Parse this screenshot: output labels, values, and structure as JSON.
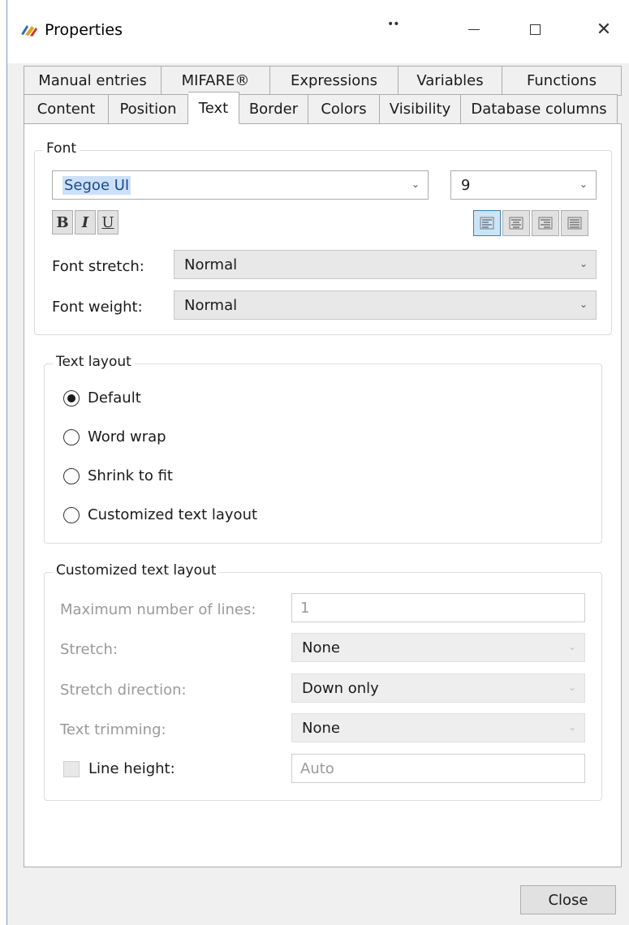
{
  "window": {
    "title": "Properties",
    "grip_glyph": "••",
    "minimize_label": "",
    "maximize_label": "",
    "close_glyph": "✕"
  },
  "tabs": {
    "back_row": [
      "Manual entries",
      "MIFARE®",
      "Expressions",
      "Variables",
      "Functions"
    ],
    "front_row": [
      "Content",
      "Position",
      "Text",
      "Border",
      "Colors",
      "Visibility",
      "Database columns"
    ],
    "active": "Text"
  },
  "font_group": {
    "label": "Font",
    "font_family": "Segoe UI",
    "font_size": "9",
    "bold_label": "B",
    "italic_label": "I",
    "underline_label": "U",
    "alignment_selected": "left",
    "font_stretch_label": "Font stretch:",
    "font_stretch_value": "Normal",
    "font_weight_label": "Font weight:",
    "font_weight_value": "Normal"
  },
  "text_layout": {
    "label": "Text layout",
    "options": [
      "Default",
      "Word wrap",
      "Shrink to fit",
      "Customized text layout"
    ],
    "selected": "Default"
  },
  "custom_layout": {
    "label": "Customized text layout",
    "max_lines_label": "Maximum number of lines:",
    "max_lines_value": "1",
    "stretch_label": "Stretch:",
    "stretch_value": "None",
    "stretch_direction_label": "Stretch direction:",
    "stretch_direction_value": "Down only",
    "text_trimming_label": "Text trimming:",
    "text_trimming_value": "None",
    "line_height_label": "Line height:",
    "line_height_value": "Auto",
    "line_height_checked": false
  },
  "footer": {
    "close_label": "Close"
  },
  "icons": {
    "app": "properties-app-icon",
    "dropdown": "chevron-down-icon"
  },
  "colors": {
    "selection_highlight": "#cce0f7",
    "active_align_button": "#cce4f7",
    "window_border": "#7a99c0"
  }
}
